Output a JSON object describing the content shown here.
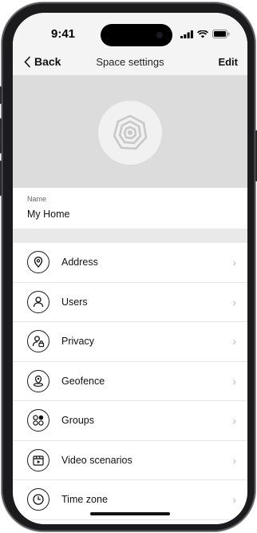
{
  "status_bar": {
    "time": "9:41"
  },
  "nav": {
    "back_label": "Back",
    "title": "Space settings",
    "edit_label": "Edit"
  },
  "name_field": {
    "label": "Name",
    "value": "My Home"
  },
  "menu": [
    {
      "label": "Address",
      "icon": "location-pin-icon"
    },
    {
      "label": "Users",
      "icon": "user-icon"
    },
    {
      "label": "Privacy",
      "icon": "user-lock-icon"
    },
    {
      "label": "Geofence",
      "icon": "geofence-icon"
    },
    {
      "label": "Groups",
      "icon": "groups-icon"
    },
    {
      "label": "Video scenarios",
      "icon": "video-scenario-icon"
    },
    {
      "label": "Time zone",
      "icon": "clock-icon"
    }
  ],
  "colors": {
    "hero_background": "#dcdcdc",
    "page_background": "#f4f4f4",
    "divider": "#e6e6e6"
  }
}
